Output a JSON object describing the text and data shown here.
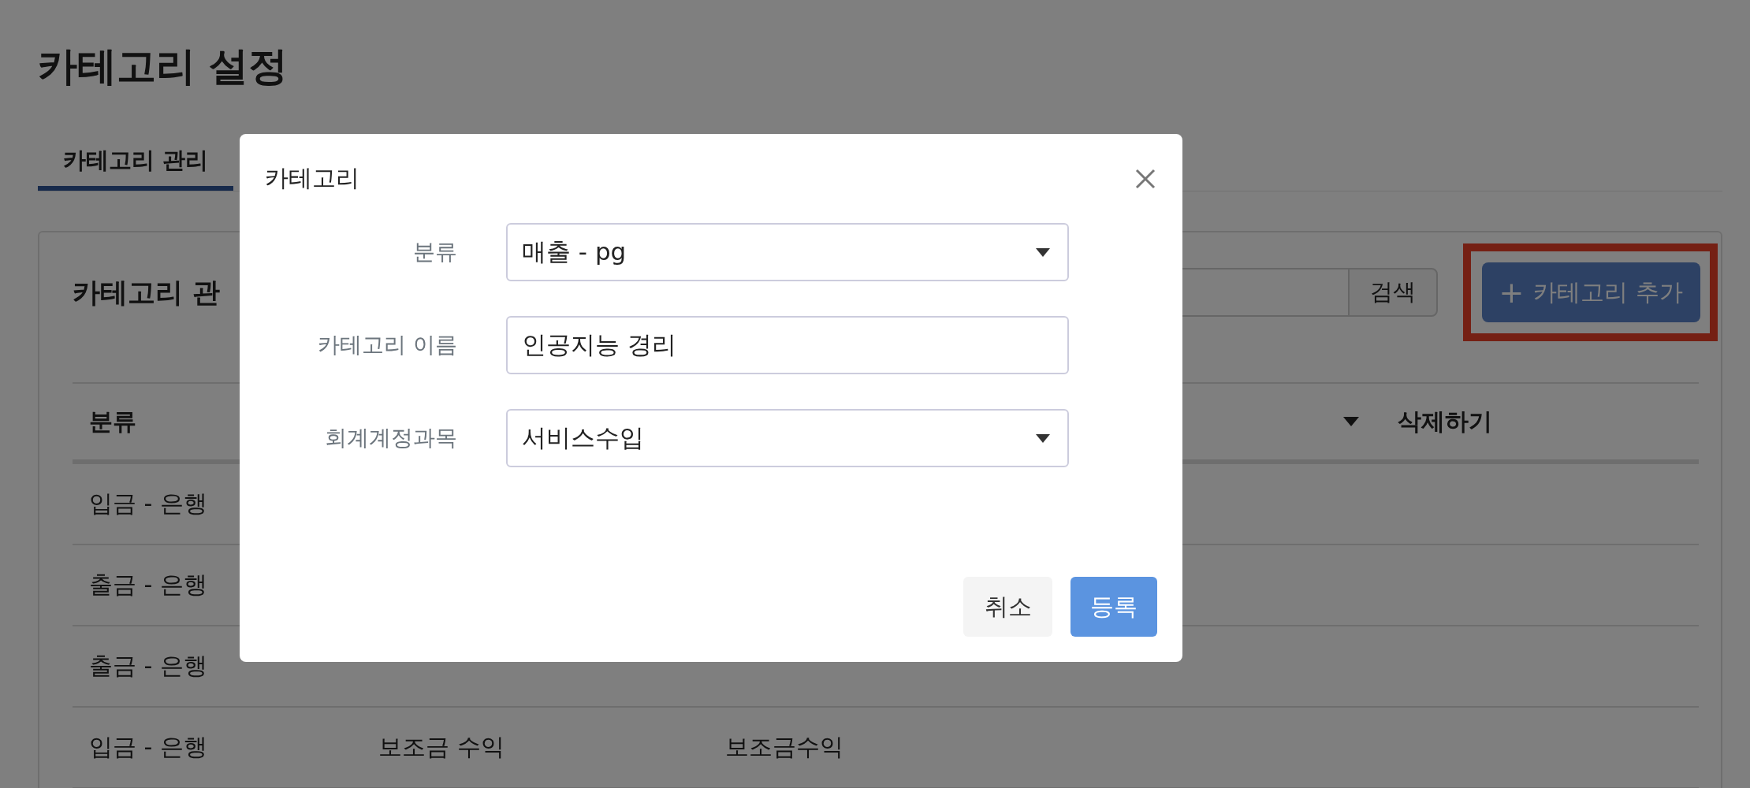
{
  "page": {
    "title": "카테고리 설정"
  },
  "tabs": [
    {
      "label": "카테고리 관리",
      "selected": true
    }
  ],
  "card": {
    "title": "카테고리 관",
    "search_button": "검색",
    "add_button": {
      "icon": "+",
      "label": "카테고리 추가",
      "highlighted": true
    }
  },
  "table": {
    "columns": [
      {
        "label": "분류"
      },
      {
        "label": "삭제하기"
      }
    ],
    "rows": [
      {
        "category": "입금 - 은행"
      },
      {
        "category": "출금 - 은행"
      },
      {
        "category": "출금 - 은행"
      },
      {
        "category": "입금 - 은행",
        "column_2": "보조금 수익",
        "column_3": "보조금수익"
      }
    ]
  },
  "modal": {
    "title": "카테고리",
    "fields": [
      {
        "kind": "select",
        "label": "분류",
        "value": "매출 - pg"
      },
      {
        "kind": "text",
        "label": "카테고리 이름",
        "value": "인공지능 경리"
      },
      {
        "kind": "select",
        "label": "회계계정과목",
        "value": "서비스수입"
      }
    ],
    "buttons": [
      {
        "kind": "secondary",
        "label": "취소"
      },
      {
        "kind": "primary",
        "label": "등록"
      }
    ]
  }
}
